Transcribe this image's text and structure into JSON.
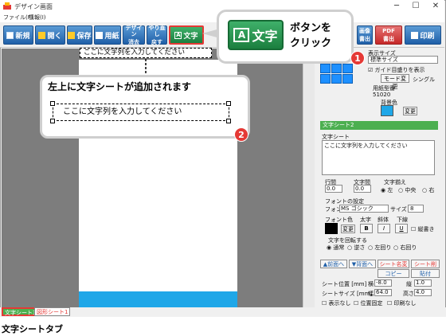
{
  "window": {
    "title": "デザイン画面",
    "controls": [
      "─",
      "☐",
      "✕"
    ]
  },
  "menu": [
    "ファイル(F)",
    "情報(I)"
  ],
  "toolbar": {
    "new": "新規",
    "open": "開く",
    "save": "保存",
    "paper": "用紙",
    "design_clear_1": "デザイン",
    "design_clear_2": "消去",
    "undo_1": "やり直し",
    "undo_2": "戻す",
    "text": "文字",
    "pdf_1": "PDF",
    "pdf_2": "書出",
    "img_1": "画像",
    "img_2": "書出",
    "print": "印刷"
  },
  "canvas": {
    "sheet_text": "ここに文字列を入力してください"
  },
  "callout_top": {
    "button_label": "文字",
    "line1": "ボタンを",
    "line2": "クリック",
    "badge": "1"
  },
  "callout_main": {
    "title": "左上に文字シートが追加されます",
    "sheet_text": "ここに文字列を入力してください",
    "badge": "2"
  },
  "right_panel": {
    "display_size_label": "表示サイズ",
    "display_size_value": "標準サイズ",
    "guide_checkbox": "ガイド目盛りを表示",
    "mode_change": "モード変更",
    "single": "シングル",
    "paper_number_label": "用紙型番",
    "paper_number_value": "51020",
    "bg_color_label": "背景色",
    "change": "変更",
    "section_title": "文字シート2",
    "text_sheet_label": "文字シート",
    "text_value": "ここに文字列を入力してください",
    "line_spacing_label": "行間",
    "line_spacing_value": "0.0",
    "char_spacing_label": "文字間",
    "char_spacing_value": "0.0",
    "align_label": "文字揃え",
    "align_left": "左",
    "align_center": "中央",
    "align_right": "右",
    "font_settings_label": "フォントの設定",
    "font_name_label": "フォント名",
    "font_name_value": "MS ゴシック",
    "size_label": "サイズ",
    "size_value": "8",
    "font_color_label": "フォント色",
    "bold_label": "太字",
    "italic_label": "斜体",
    "underline_label": "下線",
    "bold_btn": "B",
    "italic_btn": "I",
    "underline_btn": "U",
    "vertical_label": "縦書き",
    "rotate_label": "文字を回転する",
    "rotate_normal": "通常",
    "rotate_reverse": "逆さ",
    "rotate_left": "左回り",
    "rotate_right": "右回り",
    "front_btn": "▲前面へ",
    "back_btn": "▼背面へ",
    "sheet_name_change": "シート名変更",
    "sheet_delete": "シート削除",
    "copy_btn": "コピー",
    "paste_btn": "貼付",
    "pos_label": "シート位置 [mm]",
    "width_label": "横",
    "width_value": "-8.0",
    "height_label": "縦",
    "height_value": "1.0",
    "size_label2": "シートサイズ [mm]",
    "size_w_label": "幅",
    "size_w_value": "64.0",
    "size_h_label": "高さ",
    "size_h_value": "4.0",
    "hide_label": "表示なし",
    "lock_label": "位置固定",
    "noprint_label": "印刷なし"
  },
  "tabs": {
    "text_sheet": "文字シート3",
    "shape_sheet": "図形シート1"
  },
  "caption": "文字シートタブ",
  "colors": {
    "toolbar_blue": "#1f5fa8",
    "text_green": "#1b7f3f",
    "badge_red": "#e53935",
    "footer_blue": "#1fa7e8"
  }
}
